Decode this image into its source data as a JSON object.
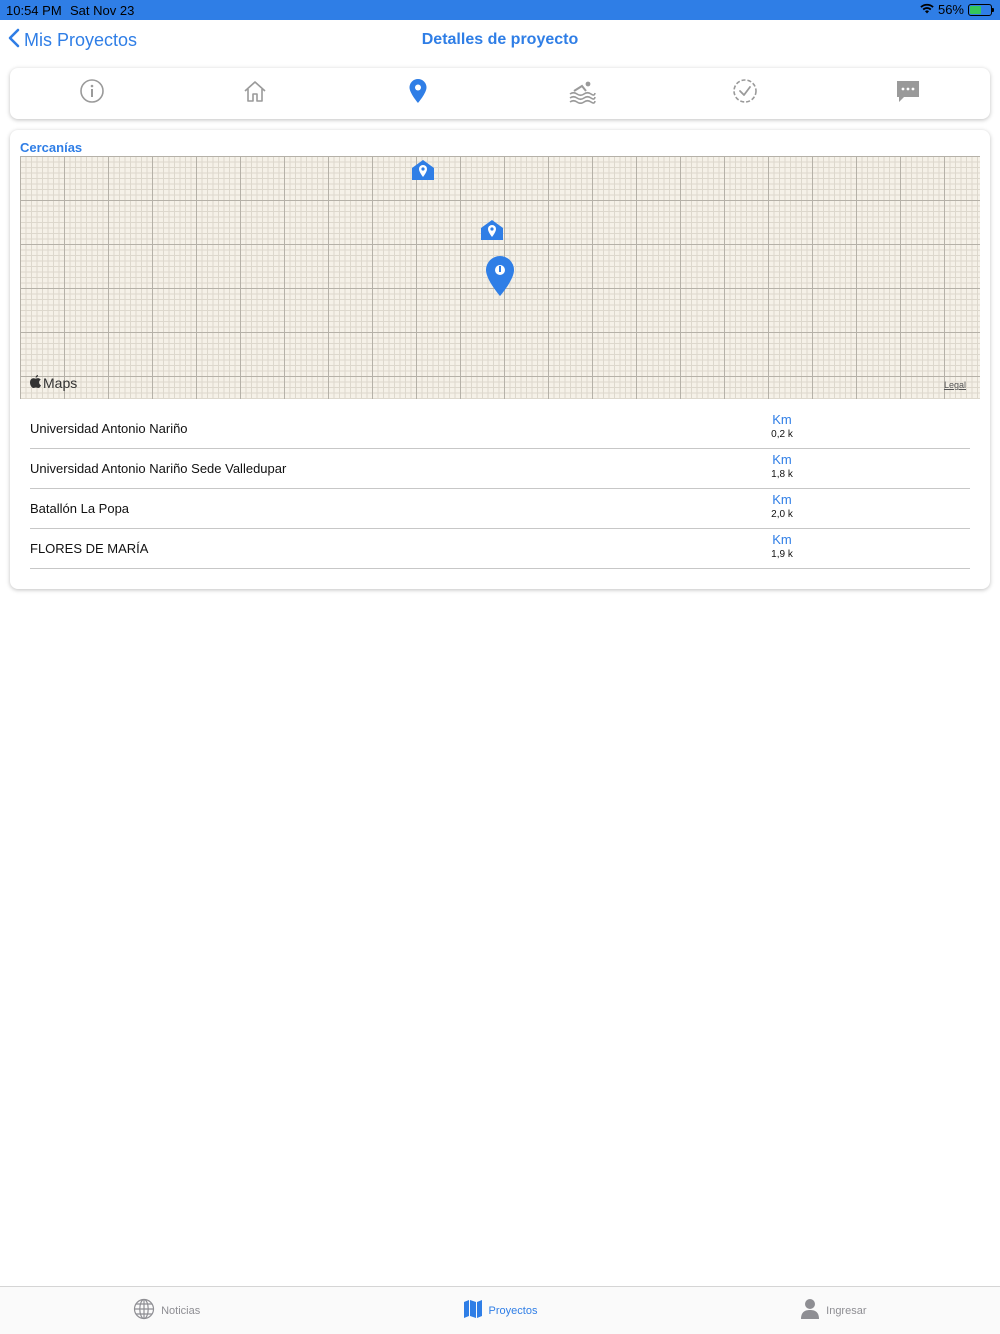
{
  "status_bar": {
    "time": "10:54 PM",
    "date": "Sat Nov 23",
    "battery": "56%"
  },
  "nav": {
    "back_label": "Mis Proyectos",
    "title": "Detalles de proyecto"
  },
  "tabs": [
    {
      "icon": "info-icon",
      "active": false
    },
    {
      "icon": "home-icon",
      "active": false
    },
    {
      "icon": "location-pin-icon",
      "active": true
    },
    {
      "icon": "pool-icon",
      "active": false
    },
    {
      "icon": "check-circle-icon",
      "active": false
    },
    {
      "icon": "chat-icon",
      "active": false
    }
  ],
  "section": {
    "title": "Cercanías"
  },
  "map": {
    "logo_text": "Maps",
    "legal_text": "Legal"
  },
  "nearby": [
    {
      "name": "Universidad Antonio Nariño",
      "unit": "Km",
      "distance": "0,2 k"
    },
    {
      "name": "Universidad Antonio Nariño Sede Valledupar",
      "unit": "Km",
      "distance": "1,8 k"
    },
    {
      "name": "Batallón La Popa",
      "unit": "Km",
      "distance": "2,0 k"
    },
    {
      "name": "FLORES DE MARÍA",
      "unit": "Km",
      "distance": "1,9 k"
    }
  ],
  "tabbar": [
    {
      "label": "Noticias",
      "active": false
    },
    {
      "label": "Proyectos",
      "active": true
    },
    {
      "label": "Ingresar",
      "active": false
    }
  ],
  "colors": {
    "accent": "#2f7ee6",
    "inactive": "#8e8e93"
  }
}
